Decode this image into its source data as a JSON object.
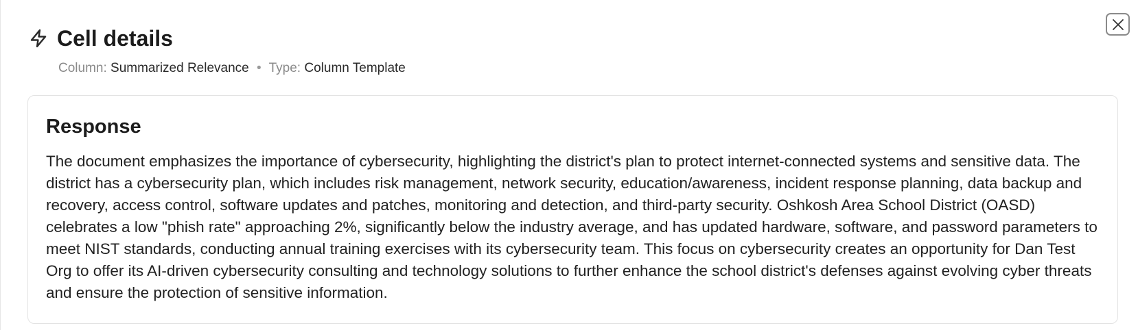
{
  "header": {
    "title": "Cell details",
    "icon": "bolt-icon"
  },
  "meta": {
    "column_label": "Column:",
    "column_value": "Summarized Relevance",
    "separator": "•",
    "type_label": "Type:",
    "type_value": "Column Template"
  },
  "close": {
    "icon": "close-icon"
  },
  "response": {
    "title": "Response",
    "text": "The document emphasizes the importance of cybersecurity, highlighting the district's plan to protect internet-connected systems and sensitive data. The district has a cybersecurity plan, which includes risk management, network security, education/awareness, incident response planning, data backup and recovery, access control, software updates and patches, monitoring and detection, and third-party security. Oshkosh Area School District (OASD) celebrates a low \"phish rate\" approaching 2%, significantly below the industry average, and has updated hardware, software, and password parameters to meet NIST standards, conducting annual training exercises with its cybersecurity team. This focus on cybersecurity creates an opportunity for Dan Test Org to offer its AI-driven cybersecurity consulting and technology solutions to further enhance the school district's defenses against evolving cyber threats and ensure the protection of sensitive information."
  },
  "colors": {
    "border": "#e3e3e3",
    "muted_text": "#8a8a8a",
    "text": "#222222"
  }
}
